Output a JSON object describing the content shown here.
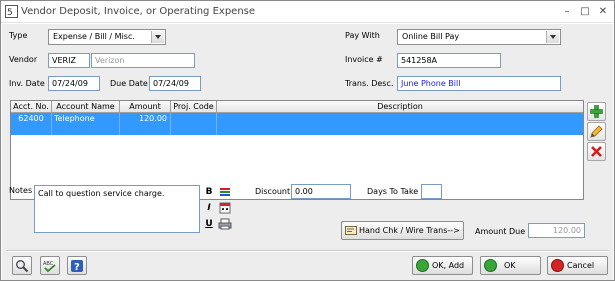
{
  "window": {
    "title": "Vendor Deposit, Invoice, or Operating Expense",
    "minimize": "–",
    "maximize": "□",
    "close": "✕"
  },
  "form": {
    "type_label": "Type",
    "type_value": "Expense / Bill / Misc.",
    "vendor_label": "Vendor",
    "vendor_code": "VERIZ",
    "vendor_name": "Verizon",
    "inv_date_label": "Inv. Date",
    "inv_date": "07/24/09",
    "due_date_label": "Due Date",
    "due_date": "07/24/09",
    "pay_with_label": "Pay With",
    "pay_with_value": "Online Bill Pay",
    "invoice_label": "Invoice #",
    "invoice_value": "541258A",
    "trans_desc_label": "Trans. Desc.",
    "trans_desc_value": "June Phone Bill"
  },
  "grid": {
    "headers": [
      "Acct. No.",
      "Account Name",
      "Amount",
      "Proj. Code",
      "Description"
    ],
    "rows": [
      {
        "acct": "62400",
        "name": "Telephone",
        "amount": "120.00",
        "proj": "",
        "desc": ""
      }
    ]
  },
  "notes": {
    "label": "Notes",
    "value": "Call to question service charge."
  },
  "format": {
    "bold": "B",
    "italic": "I",
    "underline": "U"
  },
  "discount": {
    "label": "Discount",
    "value": "0.00"
  },
  "days": {
    "label": "Days To Take",
    "value": ""
  },
  "hand_check_button": "Hand Chk / Wire Trans-->",
  "amount_due": {
    "label": "Amount Due",
    "value": "120.00"
  },
  "buttons": {
    "ok_add": "OK, Add",
    "ok": "OK",
    "cancel": "Cancel"
  },
  "colors": {
    "selection": "#3399ff",
    "field_border": "#7a9cc4",
    "link_text": "#1a1aff"
  }
}
